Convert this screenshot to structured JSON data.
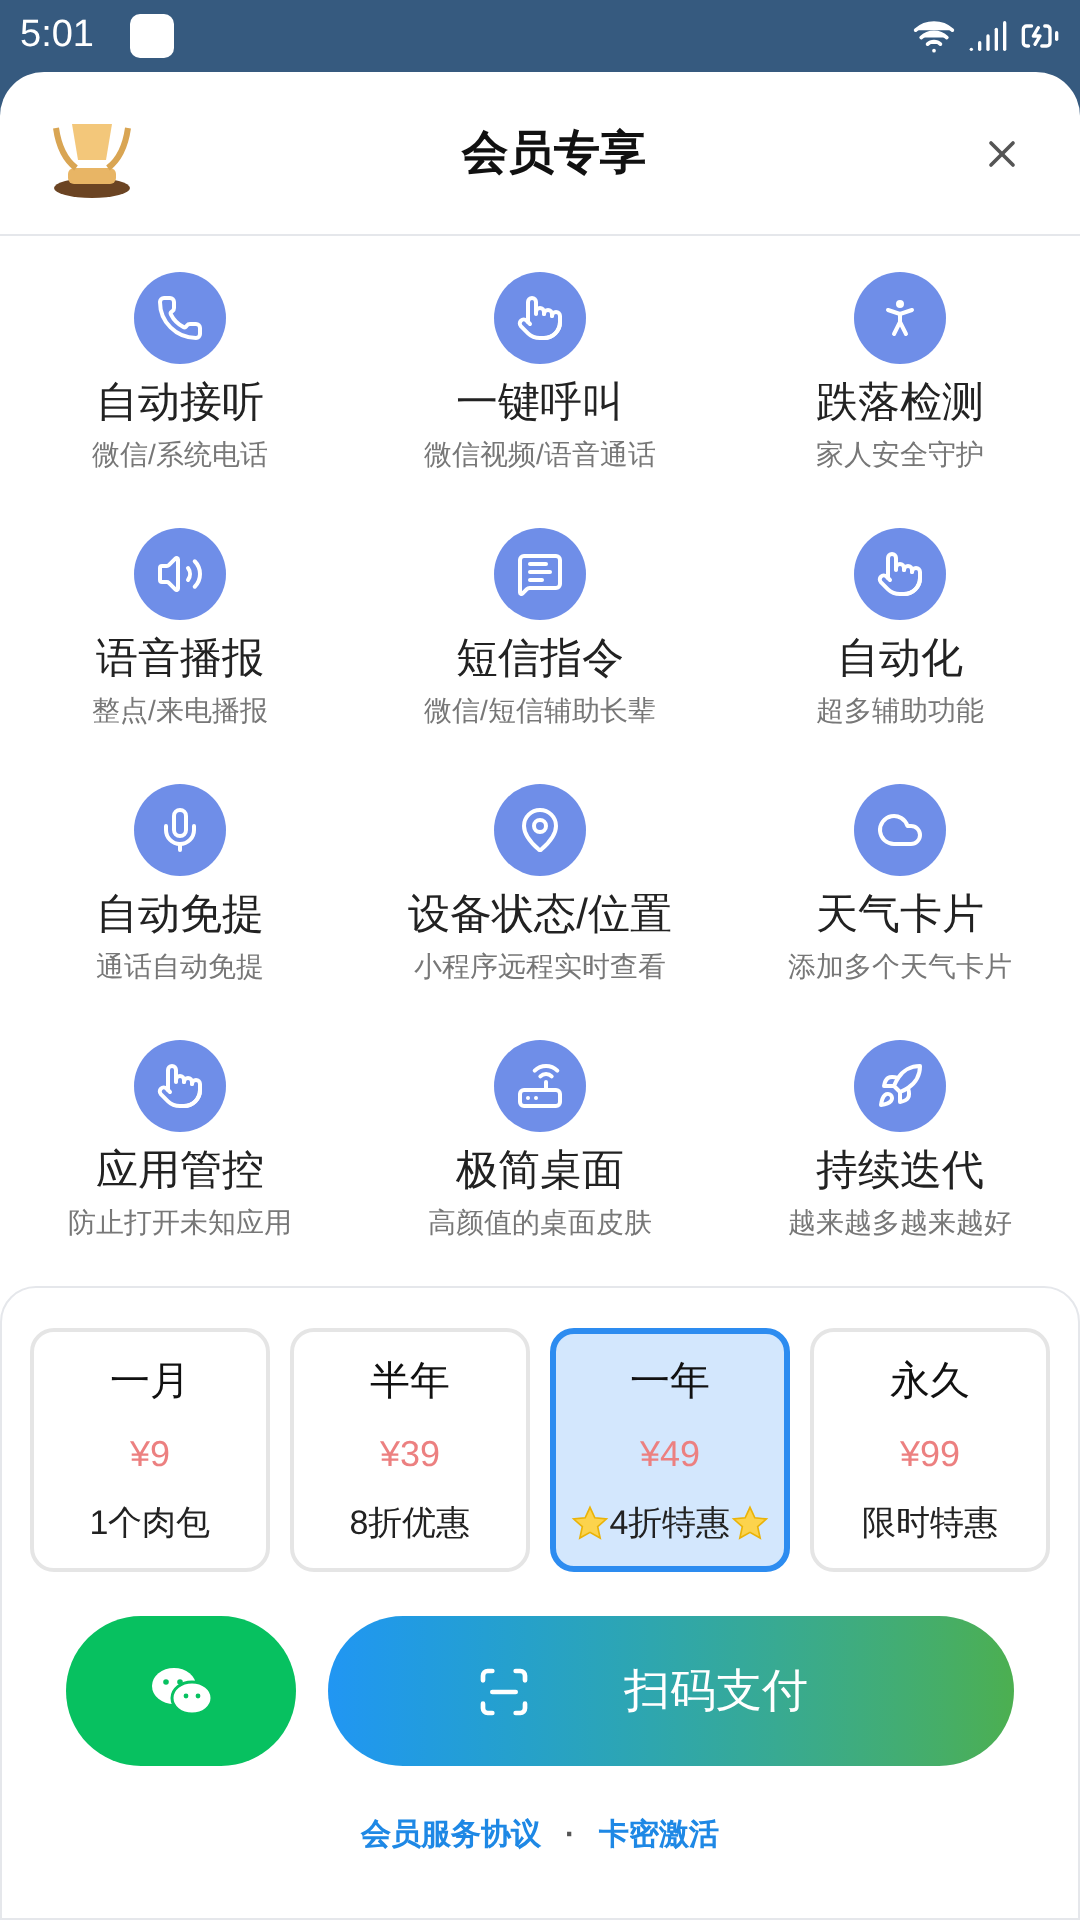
{
  "status_bar": {
    "time": "5:01"
  },
  "header": {
    "title": "会员专享"
  },
  "features": [
    {
      "title": "自动接听",
      "subtitle": "微信/系统电话"
    },
    {
      "title": "一键呼叫",
      "subtitle": "微信视频/语音通话"
    },
    {
      "title": "跌落检测",
      "subtitle": "家人安全守护"
    },
    {
      "title": "语音播报",
      "subtitle": "整点/来电播报"
    },
    {
      "title": "短信指令",
      "subtitle": "微信/短信辅助长辈"
    },
    {
      "title": "自动化",
      "subtitle": "超多辅助功能"
    },
    {
      "title": "自动免提",
      "subtitle": "通话自动免提"
    },
    {
      "title": "设备状态/位置",
      "subtitle": "小程序远程实时查看"
    },
    {
      "title": "天气卡片",
      "subtitle": "添加多个天气卡片"
    },
    {
      "title": "应用管控",
      "subtitle": "防止打开未知应用"
    },
    {
      "title": "极简桌面",
      "subtitle": "高颜值的桌面皮肤"
    },
    {
      "title": "持续迭代",
      "subtitle": "越来越多越来越好"
    }
  ],
  "plans": [
    {
      "name": "一月",
      "price": "¥9",
      "note": "1个肉包",
      "starred": false,
      "selected": false
    },
    {
      "name": "半年",
      "price": "¥39",
      "note": "8折优惠",
      "starred": false,
      "selected": false
    },
    {
      "name": "一年",
      "price": "¥49",
      "note": "4折特惠",
      "starred": true,
      "selected": true
    },
    {
      "name": "永久",
      "price": "¥99",
      "note": "限时特惠",
      "starred": false,
      "selected": false
    }
  ],
  "pay_button": {
    "label": "扫码支付"
  },
  "links": [
    "会员服务协议",
    "·",
    "卡密激活"
  ]
}
